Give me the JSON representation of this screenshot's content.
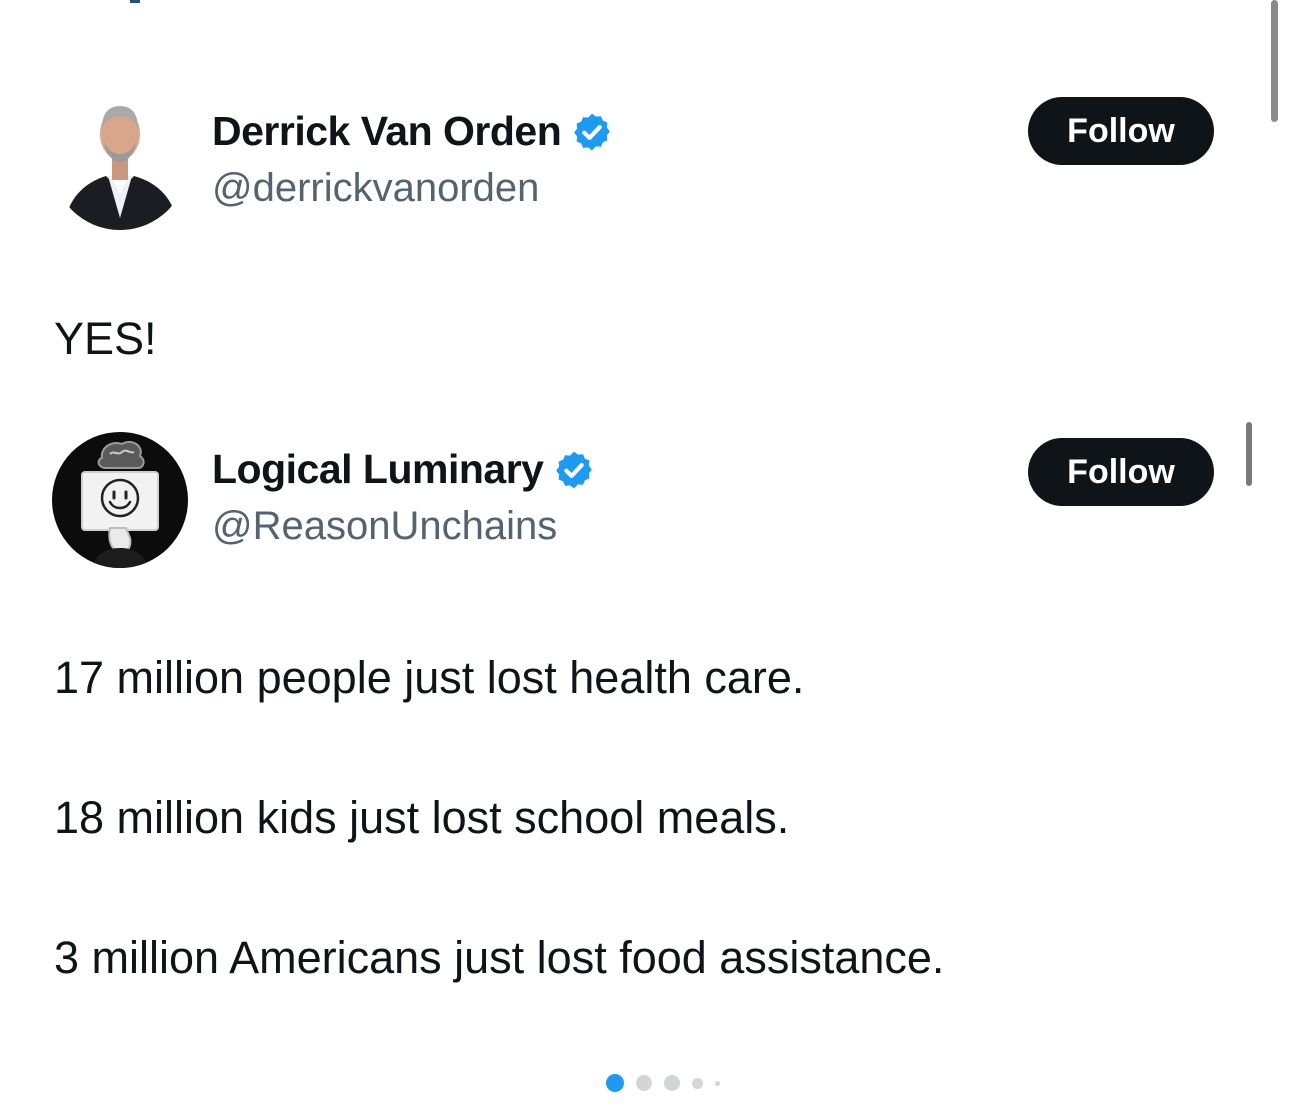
{
  "posts": [
    {
      "display_name": "Derrick Van Orden",
      "handle": "@derrickvanorden",
      "verified_icon": "verified-badge-icon",
      "follow_label": "Follow",
      "text": "YES!"
    },
    {
      "display_name": "Logical Luminary",
      "handle": "@ReasonUnchains",
      "verified_icon": "verified-badge-icon",
      "follow_label": "Follow",
      "lines": [
        "17 million people just lost health care.",
        "18 million kids just lost school meals.",
        "3 million Americans just lost food assistance."
      ]
    }
  ],
  "pager": {
    "count": 5,
    "active_index": 0
  },
  "colors": {
    "verified_blue": "#1d9bf0",
    "follow_bg": "#0f1419",
    "handle_gray": "#536471",
    "dot_inactive": "#d3d6d9"
  }
}
